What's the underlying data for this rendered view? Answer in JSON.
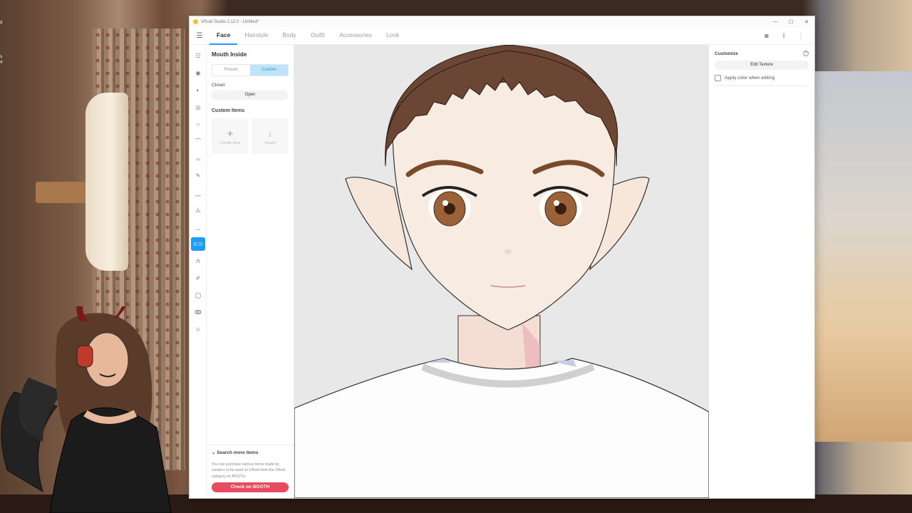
{
  "window": {
    "title": "VRoid Studio 2.12.0 - Untitled*",
    "minimize": "—",
    "maximize": "☐",
    "close": "✕"
  },
  "desktop": {
    "icon_labels": [
      "d",
      "s",
      "4"
    ]
  },
  "menubar": {
    "menu_icon": "hamburger-icon",
    "tabs": [
      "Face",
      "Hairstyle",
      "Body",
      "Outfit",
      "Accessories",
      "Look"
    ],
    "active_tab": "Face",
    "right_icons": [
      "camera-icon",
      "export-icon",
      "more-icon"
    ]
  },
  "sidebar": {
    "icons": [
      "face-preset-icon",
      "eye-icon",
      "ear-icon",
      "eye-line-icon",
      "face-shape-icon",
      "eyebrow-icon",
      "eyelash-icon",
      "pencil-icon",
      "eyelid-icon",
      "nose-icon",
      "mouth-icon",
      "mouth-inside-icon",
      "teeth-icon",
      "makeup-icon",
      "circle-icon",
      "cheek-icon",
      "face-overlay-icon"
    ],
    "active": "mouth-inside-icon"
  },
  "left_panel": {
    "title": "Mouth Inside",
    "segments": [
      "Presets",
      "Custom"
    ],
    "active_segment": "Custom",
    "closet_label": "Closet",
    "open_label": "Open",
    "custom_items_label": "Custom Items",
    "create_new": "Create New",
    "import": "Import",
    "search_more_title": "Search more items",
    "search_more_desc": "You can purchase various items made by creators to be used on VRoid from the VRoid category on BOOTH.",
    "booth_button": "Check on BOOTH"
  },
  "right_panel": {
    "title": "Customize",
    "edit_texture": "Edit Texture",
    "apply_color_label": "Apply color when editing",
    "apply_color_checked": false
  },
  "colors": {
    "accent": "#1e9df2",
    "booth": "#e84a5f",
    "skin": "#f7e9df",
    "hair": "#6b4634",
    "eye": "#9a6236"
  }
}
